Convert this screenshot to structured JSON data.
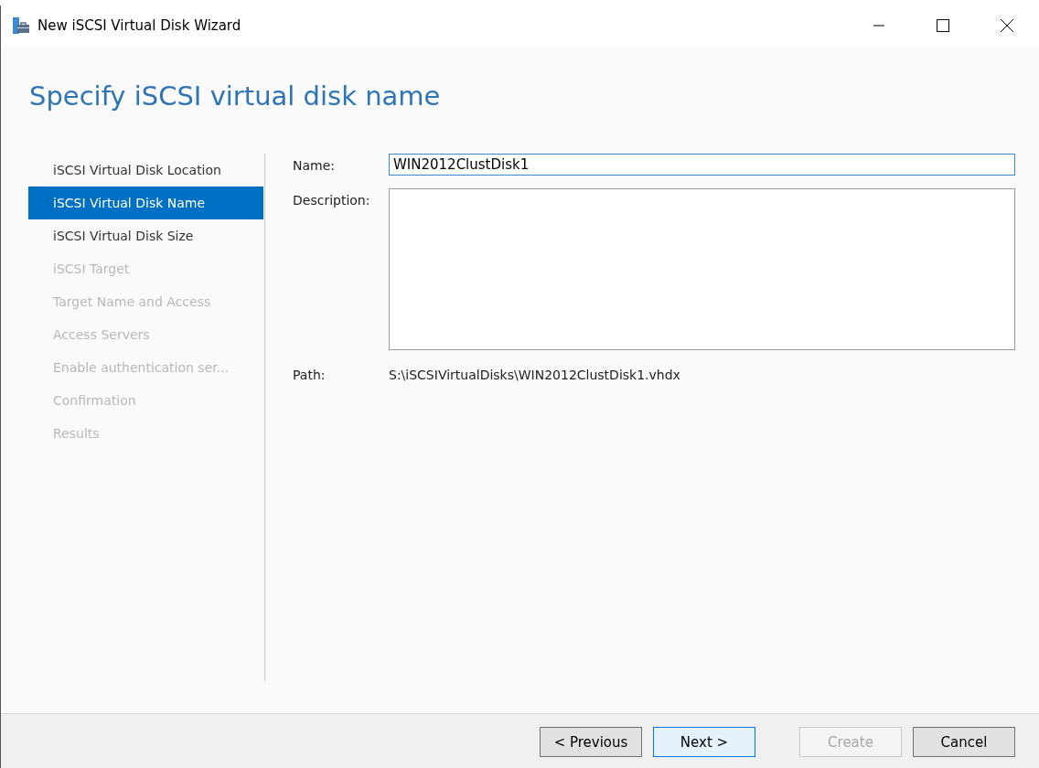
{
  "window": {
    "title": "New iSCSI Virtual Disk Wizard"
  },
  "heading": "Specify iSCSI virtual disk name",
  "sidebar": {
    "items": [
      {
        "label": "iSCSI Virtual Disk Location",
        "selected": false,
        "disabled": false
      },
      {
        "label": "iSCSI Virtual Disk Name",
        "selected": true,
        "disabled": false
      },
      {
        "label": "iSCSI Virtual Disk Size",
        "selected": false,
        "disabled": false
      },
      {
        "label": "iSCSI Target",
        "selected": false,
        "disabled": true
      },
      {
        "label": "Target Name and Access",
        "selected": false,
        "disabled": true
      },
      {
        "label": "Access Servers",
        "selected": false,
        "disabled": true
      },
      {
        "label": "Enable authentication ser...",
        "selected": false,
        "disabled": true
      },
      {
        "label": "Confirmation",
        "selected": false,
        "disabled": true
      },
      {
        "label": "Results",
        "selected": false,
        "disabled": true
      }
    ]
  },
  "form": {
    "name": {
      "label": "Name:",
      "value": "WIN2012ClustDisk1"
    },
    "description": {
      "label": "Description:"
    },
    "path": {
      "label": "Path:",
      "value": "S:\\iSCSIVirtualDisks\\WIN2012ClustDisk1.vhdx"
    }
  },
  "buttons": [
    {
      "label": "< Previous",
      "disabled": false,
      "default": false
    },
    {
      "label": "Next >",
      "disabled": false,
      "default": true
    },
    {
      "label": "Create",
      "disabled": true,
      "default": false
    },
    {
      "label": "Cancel",
      "disabled": false,
      "default": false
    }
  ]
}
